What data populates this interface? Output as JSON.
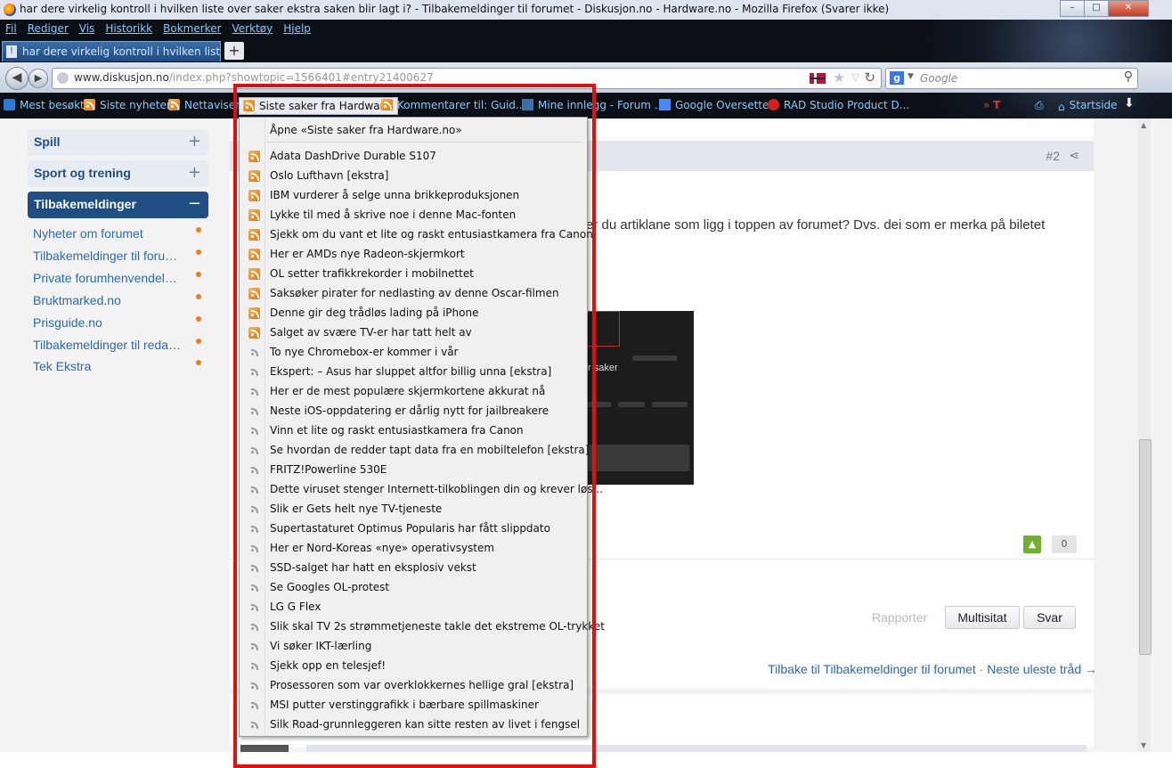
{
  "window": {
    "title": "har dere virkelig kontroll i hvilken liste over saker ekstra saken blir lagt i? - Tilbakemeldinger til forumet - Diskusjon.no - Hardware.no - Mozilla Firefox (Svarer ikke)",
    "minimize": "–",
    "maximize": "□",
    "close": "✕"
  },
  "menu": [
    "Fil",
    "Rediger",
    "Vis",
    "Historikk",
    "Bokmerker",
    "Verktøy",
    "Hjelp"
  ],
  "tab": {
    "label": "har dere virkelig kontroll i hvilken liste o...",
    "new_tab": "+"
  },
  "nav": {
    "url_domain": "www.diskusjon.no",
    "url_path": "/index.php?showtopic=1566401#entry21400627",
    "search_placeholder": "Google",
    "search_engine": "g"
  },
  "bookmarks": [
    "Mest besøkt",
    "Siste nyheter",
    "Nettavisen",
    "Siste saker fra Hardwar...",
    "Kommentarer til: Guid...",
    "Mine innlegg - Forum ...",
    "Google Oversetter",
    "RAD Studio Product D...",
    "Startside"
  ],
  "sidebar": {
    "categories": [
      {
        "label": "Spill",
        "toggle": "+"
      },
      {
        "label": "Sport og trening",
        "toggle": "+"
      },
      {
        "label": "Tilbakemeldinger",
        "toggle": "−"
      }
    ],
    "forums": [
      "Nyheter om forumet",
      "Tilbakemeldinger til forumet",
      "Private forumhenvendelser",
      "Bruktmarked.no",
      "Prisguide.no",
      "Tilbakemeldinger til redaksjonen",
      "Tek Ekstra"
    ]
  },
  "post": {
    "number": "#2",
    "text": "er du artiklane som ligg i toppen av forumet? Dvs. dei som er merka på biletet",
    "image_text": "r saker",
    "like_count": "0",
    "report": "Rapporter",
    "multiquote": "Multisitat",
    "reply": "Svar"
  },
  "thread_nav": {
    "back": "Tilbake til Tilbakemeldinger til forumet",
    "separator": "·",
    "next": "Neste uleste tråd →"
  },
  "dropdown": {
    "open_label": "Åpne «Siste saker fra Hardware.no»",
    "items": [
      {
        "text": "Adata DashDrive Durable S107",
        "unread": true
      },
      {
        "text": "Oslo Lufthavn [ekstra]",
        "unread": true
      },
      {
        "text": "IBM vurderer å selge unna brikkeproduksjonen",
        "unread": true
      },
      {
        "text": "Lykke til med å skrive noe i denne Mac-fonten",
        "unread": true
      },
      {
        "text": "Sjekk om du vant et lite og raskt entusiastkamera fra Canon",
        "unread": true
      },
      {
        "text": "Her er AMDs nye Radeon-skjermkort",
        "unread": true
      },
      {
        "text": "OL setter trafikkrekorder i mobilnettet",
        "unread": true
      },
      {
        "text": "Saksøker pirater for nedlasting av denne Oscar-filmen",
        "unread": true
      },
      {
        "text": "Denne gir deg trådløs lading på iPhone",
        "unread": true
      },
      {
        "text": "Salget av svære TV-er har tatt helt av",
        "unread": true
      },
      {
        "text": "To nye Chromebox-er kommer i vår",
        "unread": false
      },
      {
        "text": "Ekspert: – Asus har sluppet altfor billig unna [ekstra]",
        "unread": false
      },
      {
        "text": "Her er de mest populære skjermkortene akkurat nå",
        "unread": false
      },
      {
        "text": "Neste iOS-oppdatering er dårlig nytt for jailbreakere",
        "unread": false
      },
      {
        "text": "Vinn et lite og raskt entusiastkamera fra Canon",
        "unread": false
      },
      {
        "text": "Se hvordan de redder tapt data fra en mobiltelefon [ekstra]",
        "unread": false
      },
      {
        "text": "FRITZ!Powerline 530E",
        "unread": false
      },
      {
        "text": "Dette viruset stenger Internett-tilkoblingen din og krever løs...",
        "unread": false
      },
      {
        "text": "Slik er Gets helt nye TV-tjeneste",
        "unread": false
      },
      {
        "text": "Supertastaturet Optimus Popularis har fått slippdato",
        "unread": false
      },
      {
        "text": "Her er Nord-Koreas «nye» operativsystem",
        "unread": false
      },
      {
        "text": "SSD-salget har hatt en eksplosiv vekst",
        "unread": false
      },
      {
        "text": "Se Googles OL-protest",
        "unread": false
      },
      {
        "text": "LG G Flex",
        "unread": false
      },
      {
        "text": "Slik skal TV 2s strømmetjeneste takle det ekstreme OL-trykket",
        "unread": false
      },
      {
        "text": "Vi søker IKT-lærling",
        "unread": false
      },
      {
        "text": "Sjekk opp en telesjef!",
        "unread": false
      },
      {
        "text": "Prosessoren som var overklokkernes hellige gral [ekstra]",
        "unread": false
      },
      {
        "text": "MSI putter verstinggrafikk i bærbare spillmaskiner",
        "unread": false
      },
      {
        "text": "Silk Road-grunnleggeren kan sitte resten av livet i fengsel",
        "unread": false
      }
    ]
  },
  "colors": {
    "highlight_frame": "#e01010",
    "rss_orange": "#e77000",
    "link_blue": "#2a6bb3",
    "category_active": "#1f4f82",
    "unread_dot": "#f07d1a"
  }
}
